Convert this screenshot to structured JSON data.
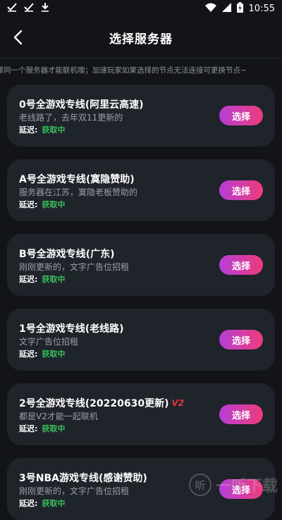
{
  "status_bar": {
    "time": "10:55"
  },
  "header": {
    "title": "选择服务器"
  },
  "notice": "选择同一个服务器才能联机噢；加速玩家如果选择的节点无法连接可更换节点~",
  "servers": [
    {
      "name": "0号全游戏专线(阿里云高速)",
      "desc": "老线路了，去年双11更新的",
      "latency_label": "延迟:",
      "latency_value": "获取中",
      "button": "选择"
    },
    {
      "name": "A号全游戏专线(寞隐赞助)",
      "desc": "服务器在江苏，寞隐老板赞助的",
      "latency_label": "延迟:",
      "latency_value": "获取中",
      "button": "选择"
    },
    {
      "name": "B号全游戏专线(广东)",
      "desc": "刚刚更新的，文字广告位招租",
      "latency_label": "延迟:",
      "latency_value": "获取中",
      "button": "选择"
    },
    {
      "name": "1号全游戏专线(老线路)",
      "desc": "文字广告位招租",
      "latency_label": "延迟:",
      "latency_value": "获取中",
      "button": "选择"
    },
    {
      "name": "2号全游戏专线(20220630更新)",
      "badge": "V2",
      "desc": "都是V2才能一起联机",
      "latency_label": "延迟:",
      "latency_value": "获取中",
      "button": "选择"
    },
    {
      "name": "3号NBA游戏专线(感谢赞助)",
      "desc": "刚刚更新的，文字广告位招租",
      "latency_label": "延迟:",
      "latency_value": "获取中",
      "button": "选择"
    }
  ],
  "watermark": "一听下载",
  "colors": {
    "background": "#121418",
    "card": "#1f232a",
    "accent_start": "#b53ed6",
    "accent_end": "#ee3b7c",
    "latency": "#39c05a"
  }
}
